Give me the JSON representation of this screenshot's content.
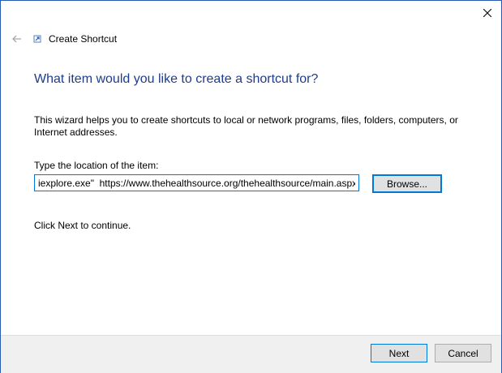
{
  "window": {
    "title": "Create Shortcut",
    "close_icon": "close-icon",
    "back_icon": "back-arrow-icon",
    "app_icon": "shortcut-icon"
  },
  "wizard": {
    "heading": "What item would you like to create a shortcut for?",
    "description": "This wizard helps you to create shortcuts to local or network programs, files, folders, computers, or Internet addresses.",
    "location_label": "Type the location of the item:",
    "location_value": "iexplore.exe\"  https://www.thehealthsource.org/thehealthsource/main.aspx",
    "browse_label": "Browse...",
    "continue_text": "Click Next to continue."
  },
  "footer": {
    "next_label": "Next",
    "cancel_label": "Cancel"
  },
  "colors": {
    "heading": "#1e3c8c",
    "accent": "#0078d7",
    "desktop": "#1c3f8f"
  }
}
